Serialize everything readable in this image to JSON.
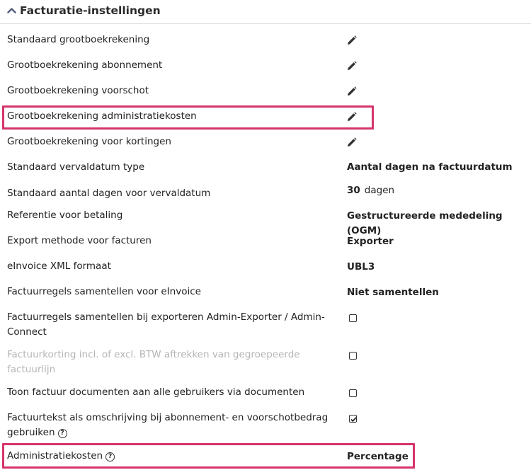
{
  "header": {
    "title": "Facturatie-instellingen"
  },
  "rows": {
    "r0": {
      "label": "Standaard grootboekrekening"
    },
    "r1": {
      "label": "Grootboekrekening abonnement"
    },
    "r2": {
      "label": "Grootboekrekening voorschot"
    },
    "r3": {
      "label": "Grootboekrekening administratiekosten"
    },
    "r4": {
      "label": "Grootboekrekening voor kortingen"
    },
    "r5": {
      "label": "Standaard vervaldatum type",
      "value": "Aantal dagen na factuurdatum"
    },
    "r6": {
      "label": "Standaard aantal dagen voor vervaldatum",
      "value": "30",
      "unit": "dagen"
    },
    "r7": {
      "label": "Referentie voor betaling",
      "value": "Gestructureerde mededeling (OGM)"
    },
    "r8": {
      "label": "Export methode voor facturen",
      "value": "Exporter"
    },
    "r9": {
      "label": "eInvoice XML formaat",
      "value": "UBL3"
    },
    "r10": {
      "label": "Factuurregels samentellen voor eInvoice",
      "value": "Niet samentellen"
    },
    "r11": {
      "label": "Factuurregels samentellen bij exporteren Admin-Exporter / Admin-Connect",
      "checked": false
    },
    "r12": {
      "label": "Factuurkorting incl. of excl. BTW aftrekken van gegroepeerde factuurlijn",
      "checked": false,
      "disabled": true
    },
    "r13": {
      "label": "Toon factuur documenten aan alle gebruikers via documenten",
      "checked": false
    },
    "r14": {
      "label": "Factuurtekst als omschrijving bij abonnement- en voorschotbedrag gebruiken",
      "checked": true
    },
    "r15": {
      "label": "Administratiekosten",
      "value": "Percentage"
    }
  },
  "icons": {
    "help": "?",
    "edit": "pencil-icon",
    "collapse": "chevron-up-icon"
  },
  "colors": {
    "highlight": "#d6336c",
    "text": "#222222",
    "disabled_text": "#b5b5b5"
  }
}
